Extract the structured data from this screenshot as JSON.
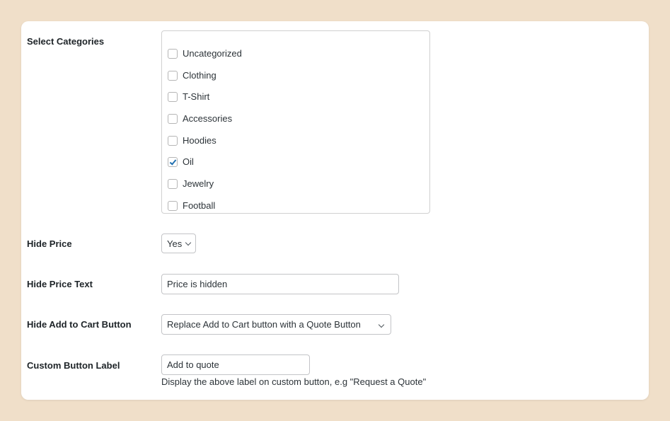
{
  "form": {
    "categories": {
      "label": "Select Categories",
      "items": [
        {
          "label": "Uncategorized",
          "checked": false
        },
        {
          "label": "Clothing",
          "checked": false
        },
        {
          "label": "T-Shirt",
          "checked": false
        },
        {
          "label": "Accessories",
          "checked": false
        },
        {
          "label": "Hoodies",
          "checked": false
        },
        {
          "label": "Oil",
          "checked": true
        },
        {
          "label": "Jewelry",
          "checked": false
        },
        {
          "label": "Football",
          "checked": false
        }
      ]
    },
    "hide_price": {
      "label": "Hide Price",
      "value": "Yes"
    },
    "hide_price_text": {
      "label": "Hide Price Text",
      "value": "Price is hidden"
    },
    "hide_add_to_cart": {
      "label": "Hide Add to Cart Button",
      "value": "Replace Add to Cart button with a Quote Button"
    },
    "custom_button_label": {
      "label": "Custom Button Label",
      "value": "Add to quote",
      "help": "Display the above label on custom button, e.g \"Request a Quote\""
    }
  },
  "colors": {
    "page_background": "#f0dfc9",
    "card_background": "#ffffff",
    "checkbox_accent": "#2271b1"
  }
}
